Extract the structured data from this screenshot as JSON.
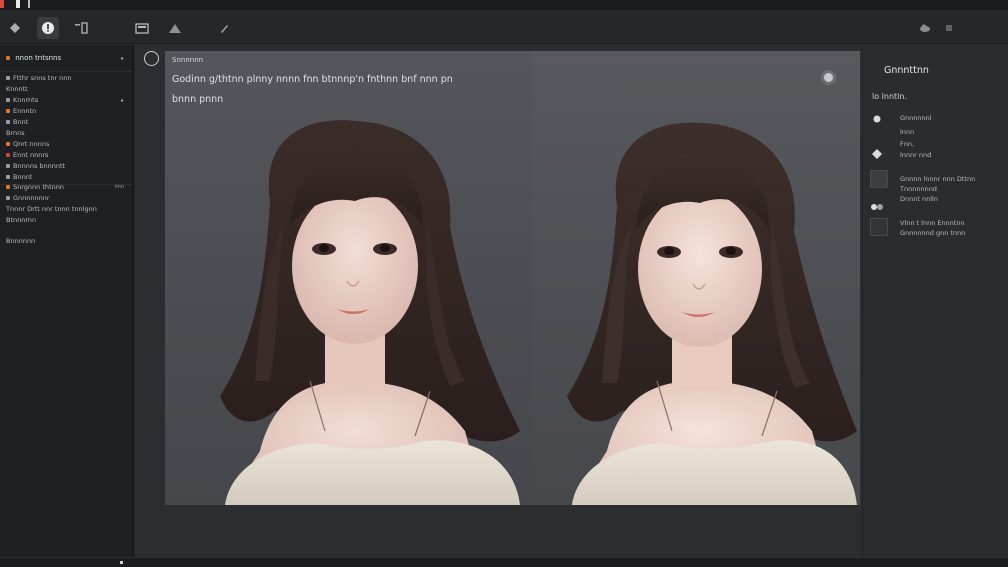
{
  "toolbar": {
    "tools": [
      {
        "name": "move",
        "icon": "diamond-icon",
        "active": false
      },
      {
        "name": "info",
        "icon": "info-icon",
        "active": true
      },
      {
        "name": "crop",
        "icon": "crop-icon",
        "active": false
      },
      {
        "name": "image",
        "icon": "image-icon",
        "active": false
      },
      {
        "name": "shape",
        "icon": "triangle-icon",
        "active": false
      },
      {
        "name": "brush",
        "icon": "brush-icon",
        "active": false
      }
    ],
    "right_icons": [
      "cloud-icon",
      "settings-icon"
    ]
  },
  "sidebar": {
    "header": "nnon tntsnns",
    "items": [
      {
        "label": "Ftthr snns tnr nnn",
        "bullet": "none",
        "chevron": false
      },
      {
        "label": "Knnntt",
        "bullet": "none",
        "chevron": false
      },
      {
        "label": "Knnrnts",
        "bullet": "none",
        "chevron": true
      },
      {
        "label": "Ennntn",
        "bullet": "orange",
        "chevron": false
      },
      {
        "label": "Bnnt",
        "bullet": "none",
        "chevron": false
      },
      {
        "label": "Brnns",
        "bullet": "none",
        "chevron": false
      },
      {
        "label": "Qnrt nnnns",
        "bullet": "none",
        "chevron": false
      },
      {
        "label": "Ennt nnnrs",
        "bullet": "red",
        "chevron": false
      },
      {
        "label": "Bnnnns bnnnntt",
        "bullet": "none",
        "chevron": false
      },
      {
        "label": "Bnnnt",
        "bullet": "none",
        "chevron": false
      },
      {
        "label": "Snrgnnn thtnnn",
        "bullet": "orange",
        "chevron": false,
        "badge": "nnn"
      },
      {
        "label": "Gnnnnnnnr",
        "bullet": "none",
        "chevron": false
      },
      {
        "label": "Tnnnr Drtt nnr tnnn tnnlgnn",
        "bullet": "none",
        "chevron": false
      },
      {
        "label": "Btnnnrnn",
        "bullet": "none",
        "chevron": false
      },
      {
        "label": "Bnnnnnn",
        "bullet": "none",
        "chevron": false
      }
    ]
  },
  "canvas": {
    "overlay_title": "Snnnnnn",
    "overlay_line1": "Godinn g/thtnn plnny nnnn fnn btnnnp'n fnthnn bnf nnn pn",
    "overlay_line2": "bnnn pnnn"
  },
  "right_panel": {
    "title": "Gnnnttnn",
    "subtitle": "lo   lnntln.",
    "rows": [
      {
        "icon": "dot-icon",
        "lines": [
          "Gnnnnnnl",
          "lnnn",
          "Fnn,",
          "lnnnr nnd"
        ]
      },
      {
        "icon": "swatch-icon",
        "lines": [
          "Gnnnn lnnnr nnn Dttnn",
          "Tnnnnnnnd",
          "Dnnnt nnlln"
        ]
      },
      {
        "icon": "toggle-icon",
        "lines": [
          "Vlnn t lnnn Ennntnn",
          "Gnnnnnnd gnn tnnn"
        ]
      }
    ]
  },
  "colors": {
    "background": "#2a2b2f",
    "panel": "#1f2023",
    "accent_orange": "#e0752c",
    "accent_red": "#d9413a"
  }
}
